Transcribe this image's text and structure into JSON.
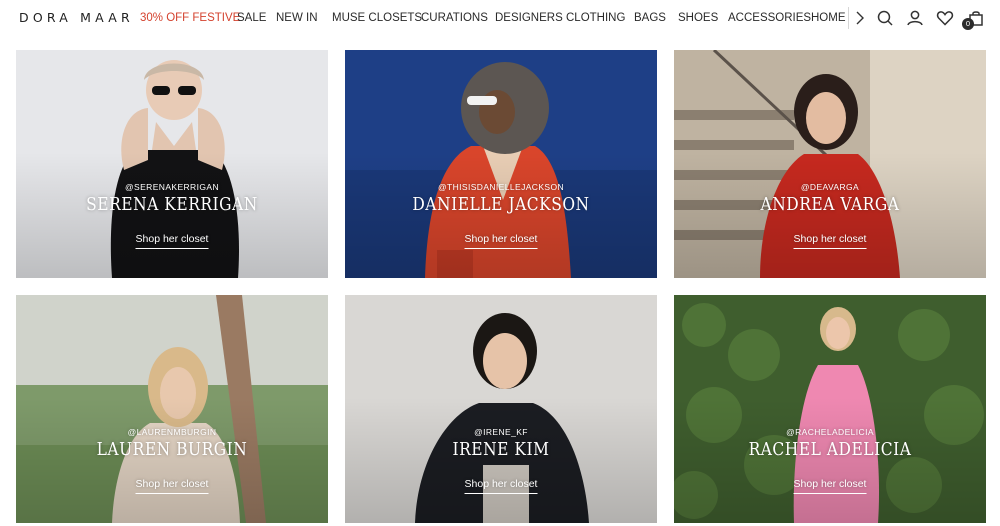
{
  "header": {
    "logo": "DORA MAAR",
    "nav": [
      {
        "label": "30% OFF FESTIVE",
        "promo": true
      },
      {
        "label": "SALE"
      },
      {
        "label": "NEW IN"
      },
      {
        "label": "MUSE CLOSETS"
      },
      {
        "label": "CURATIONS"
      },
      {
        "label": "DESIGNERS"
      },
      {
        "label": "CLOTHING"
      },
      {
        "label": "BAGS"
      },
      {
        "label": "SHOES"
      },
      {
        "label": "ACCESSORIES"
      },
      {
        "label": "HOME"
      }
    ],
    "icons": [
      "chevron-right-icon",
      "search-icon",
      "account-icon",
      "heart-icon",
      "bag-icon"
    ],
    "cart_count": "0",
    "promo_color": "#d4422e"
  },
  "closets": [
    {
      "handle": "@SERENAKERRIGAN",
      "name": "SERENA KERRIGAN",
      "cta": "Shop her closet"
    },
    {
      "handle": "@THISISDANIELLEJACKSON",
      "name": "DANIELLE JACKSON",
      "cta": "Shop her closet"
    },
    {
      "handle": "@DEAVARGA",
      "name": "ANDREA VARGA",
      "cta": "Shop her closet"
    },
    {
      "handle": "@LAURENMBURGIN",
      "name": "LAUREN BURGIN",
      "cta": "Shop her closet"
    },
    {
      "handle": "@IRENE_KF",
      "name": "IRENE KIM",
      "cta": "Shop her closet"
    },
    {
      "handle": "@RACHELADELICIA",
      "name": "RACHEL ADELICIA",
      "cta": "Shop her closet"
    }
  ]
}
